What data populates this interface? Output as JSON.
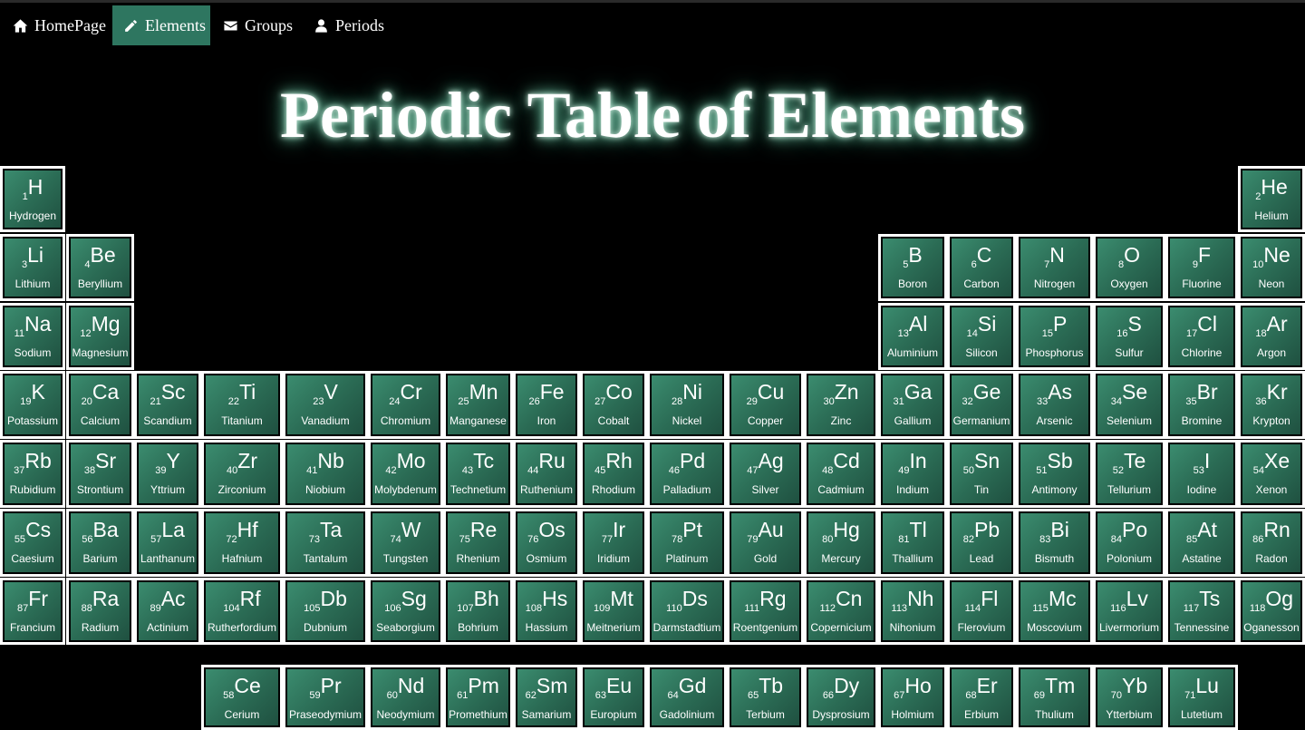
{
  "nav": [
    {
      "label": "HomePage",
      "icon": "home-icon",
      "active": false
    },
    {
      "label": "Elements",
      "icon": "pencil-icon",
      "active": true
    },
    {
      "label": "Groups",
      "icon": "envelope-icon",
      "active": false
    },
    {
      "label": "Periods",
      "icon": "user-icon",
      "active": false
    }
  ],
  "title": "Periodic Table of Elements",
  "colors": {
    "background": "#000000",
    "tile": "#2e7660",
    "active_nav": "#2e7660",
    "border": "#ffffff",
    "glow": "#7fd0b0"
  },
  "elements": [
    {
      "n": "1",
      "s": "H",
      "name": "Hydrogen",
      "row": 0,
      "col": 0
    },
    {
      "n": "2",
      "s": "He",
      "name": "Helium",
      "row": 0,
      "col": 17
    },
    {
      "n": "3",
      "s": "Li",
      "name": "Lithium",
      "row": 1,
      "col": 0
    },
    {
      "n": "4",
      "s": "Be",
      "name": "Beryllium",
      "row": 1,
      "col": 1
    },
    {
      "n": "5",
      "s": "B",
      "name": "Boron",
      "row": 1,
      "col": 12
    },
    {
      "n": "6",
      "s": "C",
      "name": "Carbon",
      "row": 1,
      "col": 13
    },
    {
      "n": "7",
      "s": "N",
      "name": "Nitrogen",
      "row": 1,
      "col": 14
    },
    {
      "n": "8",
      "s": "O",
      "name": "Oxygen",
      "row": 1,
      "col": 15
    },
    {
      "n": "9",
      "s": "F",
      "name": "Fluorine",
      "row": 1,
      "col": 16
    },
    {
      "n": "10",
      "s": "Ne",
      "name": "Neon",
      "row": 1,
      "col": 17
    },
    {
      "n": "11",
      "s": "Na",
      "name": "Sodium",
      "row": 2,
      "col": 0
    },
    {
      "n": "12",
      "s": "Mg",
      "name": "Magnesium",
      "row": 2,
      "col": 1
    },
    {
      "n": "13",
      "s": "Al",
      "name": "Aluminium",
      "row": 2,
      "col": 12
    },
    {
      "n": "14",
      "s": "Si",
      "name": "Silicon",
      "row": 2,
      "col": 13
    },
    {
      "n": "15",
      "s": "P",
      "name": "Phosphorus",
      "row": 2,
      "col": 14
    },
    {
      "n": "16",
      "s": "S",
      "name": "Sulfur",
      "row": 2,
      "col": 15
    },
    {
      "n": "17",
      "s": "Cl",
      "name": "Chlorine",
      "row": 2,
      "col": 16
    },
    {
      "n": "18",
      "s": "Ar",
      "name": "Argon",
      "row": 2,
      "col": 17
    },
    {
      "n": "19",
      "s": "K",
      "name": "Potassium",
      "row": 3,
      "col": 0
    },
    {
      "n": "20",
      "s": "Ca",
      "name": "Calcium",
      "row": 3,
      "col": 1
    },
    {
      "n": "21",
      "s": "Sc",
      "name": "Scandium",
      "row": 3,
      "col": 2
    },
    {
      "n": "22",
      "s": "Ti",
      "name": "Titanium",
      "row": 3,
      "col": 3
    },
    {
      "n": "23",
      "s": "V",
      "name": "Vanadium",
      "row": 3,
      "col": 4
    },
    {
      "n": "24",
      "s": "Cr",
      "name": "Chromium",
      "row": 3,
      "col": 5
    },
    {
      "n": "25",
      "s": "Mn",
      "name": "Manganese",
      "row": 3,
      "col": 6
    },
    {
      "n": "26",
      "s": "Fe",
      "name": "Iron",
      "row": 3,
      "col": 7
    },
    {
      "n": "27",
      "s": "Co",
      "name": "Cobalt",
      "row": 3,
      "col": 8
    },
    {
      "n": "28",
      "s": "Ni",
      "name": "Nickel",
      "row": 3,
      "col": 9
    },
    {
      "n": "29",
      "s": "Cu",
      "name": "Copper",
      "row": 3,
      "col": 10
    },
    {
      "n": "30",
      "s": "Zn",
      "name": "Zinc",
      "row": 3,
      "col": 11
    },
    {
      "n": "31",
      "s": "Ga",
      "name": "Gallium",
      "row": 3,
      "col": 12
    },
    {
      "n": "32",
      "s": "Ge",
      "name": "Germanium",
      "row": 3,
      "col": 13
    },
    {
      "n": "33",
      "s": "As",
      "name": "Arsenic",
      "row": 3,
      "col": 14
    },
    {
      "n": "34",
      "s": "Se",
      "name": "Selenium",
      "row": 3,
      "col": 15
    },
    {
      "n": "35",
      "s": "Br",
      "name": "Bromine",
      "row": 3,
      "col": 16
    },
    {
      "n": "36",
      "s": "Kr",
      "name": "Krypton",
      "row": 3,
      "col": 17
    },
    {
      "n": "37",
      "s": "Rb",
      "name": "Rubidium",
      "row": 4,
      "col": 0
    },
    {
      "n": "38",
      "s": "Sr",
      "name": "Strontium",
      "row": 4,
      "col": 1
    },
    {
      "n": "39",
      "s": "Y",
      "name": "Yttrium",
      "row": 4,
      "col": 2
    },
    {
      "n": "40",
      "s": "Zr",
      "name": "Zirconium",
      "row": 4,
      "col": 3
    },
    {
      "n": "41",
      "s": "Nb",
      "name": "Niobium",
      "row": 4,
      "col": 4
    },
    {
      "n": "42",
      "s": "Mo",
      "name": "Molybdenum",
      "row": 4,
      "col": 5
    },
    {
      "n": "43",
      "s": "Tc",
      "name": "Technetium",
      "row": 4,
      "col": 6
    },
    {
      "n": "44",
      "s": "Ru",
      "name": "Ruthenium",
      "row": 4,
      "col": 7
    },
    {
      "n": "45",
      "s": "Rh",
      "name": "Rhodium",
      "row": 4,
      "col": 8
    },
    {
      "n": "46",
      "s": "Pd",
      "name": "Palladium",
      "row": 4,
      "col": 9
    },
    {
      "n": "47",
      "s": "Ag",
      "name": "Silver",
      "row": 4,
      "col": 10
    },
    {
      "n": "48",
      "s": "Cd",
      "name": "Cadmium",
      "row": 4,
      "col": 11
    },
    {
      "n": "49",
      "s": "In",
      "name": "Indium",
      "row": 4,
      "col": 12
    },
    {
      "n": "50",
      "s": "Sn",
      "name": "Tin",
      "row": 4,
      "col": 13
    },
    {
      "n": "51",
      "s": "Sb",
      "name": "Antimony",
      "row": 4,
      "col": 14
    },
    {
      "n": "52",
      "s": "Te",
      "name": "Tellurium",
      "row": 4,
      "col": 15
    },
    {
      "n": "53",
      "s": "I",
      "name": "Iodine",
      "row": 4,
      "col": 16
    },
    {
      "n": "54",
      "s": "Xe",
      "name": "Xenon",
      "row": 4,
      "col": 17
    },
    {
      "n": "55",
      "s": "Cs",
      "name": "Caesium",
      "row": 5,
      "col": 0
    },
    {
      "n": "56",
      "s": "Ba",
      "name": "Barium",
      "row": 5,
      "col": 1
    },
    {
      "n": "57",
      "s": "La",
      "name": "Lanthanum",
      "row": 5,
      "col": 2
    },
    {
      "n": "72",
      "s": "Hf",
      "name": "Hafnium",
      "row": 5,
      "col": 3
    },
    {
      "n": "73",
      "s": "Ta",
      "name": "Tantalum",
      "row": 5,
      "col": 4
    },
    {
      "n": "74",
      "s": "W",
      "name": "Tungsten",
      "row": 5,
      "col": 5
    },
    {
      "n": "75",
      "s": "Re",
      "name": "Rhenium",
      "row": 5,
      "col": 6
    },
    {
      "n": "76",
      "s": "Os",
      "name": "Osmium",
      "row": 5,
      "col": 7
    },
    {
      "n": "77",
      "s": "Ir",
      "name": "Iridium",
      "row": 5,
      "col": 8
    },
    {
      "n": "78",
      "s": "Pt",
      "name": "Platinum",
      "row": 5,
      "col": 9
    },
    {
      "n": "79",
      "s": "Au",
      "name": "Gold",
      "row": 5,
      "col": 10
    },
    {
      "n": "80",
      "s": "Hg",
      "name": "Mercury",
      "row": 5,
      "col": 11
    },
    {
      "n": "81",
      "s": "Tl",
      "name": "Thallium",
      "row": 5,
      "col": 12
    },
    {
      "n": "82",
      "s": "Pb",
      "name": "Lead",
      "row": 5,
      "col": 13
    },
    {
      "n": "83",
      "s": "Bi",
      "name": "Bismuth",
      "row": 5,
      "col": 14
    },
    {
      "n": "84",
      "s": "Po",
      "name": "Polonium",
      "row": 5,
      "col": 15
    },
    {
      "n": "85",
      "s": "At",
      "name": "Astatine",
      "row": 5,
      "col": 16
    },
    {
      "n": "86",
      "s": "Rn",
      "name": "Radon",
      "row": 5,
      "col": 17
    },
    {
      "n": "87",
      "s": "Fr",
      "name": "Francium",
      "row": 6,
      "col": 0
    },
    {
      "n": "88",
      "s": "Ra",
      "name": "Radium",
      "row": 6,
      "col": 1
    },
    {
      "n": "89",
      "s": "Ac",
      "name": "Actinium",
      "row": 6,
      "col": 2
    },
    {
      "n": "104",
      "s": "Rf",
      "name": "Rutherfordium",
      "row": 6,
      "col": 3
    },
    {
      "n": "105",
      "s": "Db",
      "name": "Dubnium",
      "row": 6,
      "col": 4
    },
    {
      "n": "106",
      "s": "Sg",
      "name": "Seaborgium",
      "row": 6,
      "col": 5
    },
    {
      "n": "107",
      "s": "Bh",
      "name": "Bohrium",
      "row": 6,
      "col": 6
    },
    {
      "n": "108",
      "s": "Hs",
      "name": "Hassium",
      "row": 6,
      "col": 7
    },
    {
      "n": "109",
      "s": "Mt",
      "name": "Meitnerium",
      "row": 6,
      "col": 8
    },
    {
      "n": "110",
      "s": "Ds",
      "name": "Darmstadtium",
      "row": 6,
      "col": 9
    },
    {
      "n": "111",
      "s": "Rg",
      "name": "Roentgenium",
      "row": 6,
      "col": 10
    },
    {
      "n": "112",
      "s": "Cn",
      "name": "Copernicium",
      "row": 6,
      "col": 11
    },
    {
      "n": "113",
      "s": "Nh",
      "name": "Nihonium",
      "row": 6,
      "col": 12
    },
    {
      "n": "114",
      "s": "Fl",
      "name": "Flerovium",
      "row": 6,
      "col": 13
    },
    {
      "n": "115",
      "s": "Mc",
      "name": "Moscovium",
      "row": 6,
      "col": 14
    },
    {
      "n": "116",
      "s": "Lv",
      "name": "Livermorium",
      "row": 6,
      "col": 15
    },
    {
      "n": "117",
      "s": "Ts",
      "name": "Tennessine",
      "row": 6,
      "col": 16
    },
    {
      "n": "118",
      "s": "Og",
      "name": "Oganesson",
      "row": 6,
      "col": 17
    },
    {
      "n": "58",
      "s": "Ce",
      "name": "Cerium",
      "row": 7,
      "col": 3
    },
    {
      "n": "59",
      "s": "Pr",
      "name": "Praseodymium",
      "row": 7,
      "col": 4
    },
    {
      "n": "60",
      "s": "Nd",
      "name": "Neodymium",
      "row": 7,
      "col": 5
    },
    {
      "n": "61",
      "s": "Pm",
      "name": "Promethium",
      "row": 7,
      "col": 6
    },
    {
      "n": "62",
      "s": "Sm",
      "name": "Samarium",
      "row": 7,
      "col": 7
    },
    {
      "n": "63",
      "s": "Eu",
      "name": "Europium",
      "row": 7,
      "col": 8
    },
    {
      "n": "64",
      "s": "Gd",
      "name": "Gadolinium",
      "row": 7,
      "col": 9
    },
    {
      "n": "65",
      "s": "Tb",
      "name": "Terbium",
      "row": 7,
      "col": 10
    },
    {
      "n": "66",
      "s": "Dy",
      "name": "Dysprosium",
      "row": 7,
      "col": 11
    },
    {
      "n": "67",
      "s": "Ho",
      "name": "Holmium",
      "row": 7,
      "col": 12
    },
    {
      "n": "68",
      "s": "Er",
      "name": "Erbium",
      "row": 7,
      "col": 13
    },
    {
      "n": "69",
      "s": "Tm",
      "name": "Thulium",
      "row": 7,
      "col": 14
    },
    {
      "n": "70",
      "s": "Yb",
      "name": "Ytterbium",
      "row": 7,
      "col": 15
    },
    {
      "n": "71",
      "s": "Lu",
      "name": "Lutetium",
      "row": 7,
      "col": 16
    }
  ]
}
